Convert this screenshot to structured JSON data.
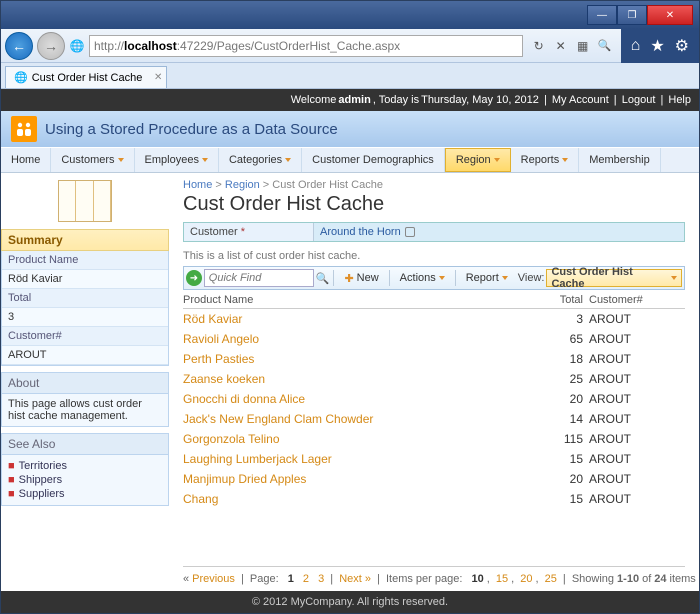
{
  "url": {
    "scheme": "http://",
    "host": "localhost",
    "port": ":47229",
    "path": "/Pages/CustOrderHist_Cache.aspx"
  },
  "tab_title": "Cust Order Hist Cache",
  "topbar": {
    "welcome_prefix": "Welcome ",
    "user": "admin",
    "date_prefix": ", Today is ",
    "date": "Thursday, May 10, 2012",
    "my_account": "My Account",
    "logout": "Logout",
    "help": "Help"
  },
  "app_title": "Using a Stored Procedure as a Data Source",
  "nav": {
    "home": "Home",
    "customers": "Customers",
    "employees": "Employees",
    "categories": "Categories",
    "customer_demo": "Customer Demographics",
    "region": "Region",
    "reports": "Reports",
    "membership": "Membership"
  },
  "sidebar": {
    "summary_h": "Summary",
    "product_name_lbl": "Product Name",
    "product_name_val": "Röd Kaviar",
    "total_lbl": "Total",
    "total_val": "3",
    "customer_lbl": "Customer#",
    "customer_val": "AROUT",
    "about_h": "About",
    "about_txt": "This page allows cust order hist cache management.",
    "seealso_h": "See Also",
    "links": [
      "Territories",
      "Shippers",
      "Suppliers"
    ]
  },
  "breadcrumb": {
    "home": "Home",
    "region": "Region",
    "leaf": "Cust Order Hist Cache"
  },
  "page_title": "Cust Order Hist Cache",
  "form": {
    "customer_lbl": "Customer",
    "customer_val": "Around the Horn"
  },
  "list_desc": "This is a list of cust order hist cache.",
  "toolbar": {
    "quick_find": "Quick Find",
    "new": "New",
    "actions": "Actions",
    "report": "Report",
    "view_lbl": "View:",
    "view_val": "Cust Order Hist Cache"
  },
  "columns": {
    "name": "Product Name",
    "total": "Total",
    "cust": "Customer#"
  },
  "rows": [
    {
      "name": "Röd Kaviar",
      "total": 3,
      "cust": "AROUT"
    },
    {
      "name": "Ravioli Angelo",
      "total": 65,
      "cust": "AROUT"
    },
    {
      "name": "Perth Pasties",
      "total": 18,
      "cust": "AROUT"
    },
    {
      "name": "Zaanse koeken",
      "total": 25,
      "cust": "AROUT"
    },
    {
      "name": "Gnocchi di donna Alice",
      "total": 20,
      "cust": "AROUT"
    },
    {
      "name": "Jack's New England Clam Chowder",
      "total": 14,
      "cust": "AROUT"
    },
    {
      "name": "Gorgonzola Telino",
      "total": 115,
      "cust": "AROUT"
    },
    {
      "name": "Laughing Lumberjack Lager",
      "total": 15,
      "cust": "AROUT"
    },
    {
      "name": "Manjimup Dried Apples",
      "total": 20,
      "cust": "AROUT"
    },
    {
      "name": "Chang",
      "total": 15,
      "cust": "AROUT"
    }
  ],
  "pager": {
    "prev": "Previous",
    "page_lbl": "Page:",
    "pages": [
      "1",
      "2",
      "3"
    ],
    "next": "Next »",
    "ipp_lbl": "Items per page:",
    "ipp": [
      "10",
      "15",
      "20",
      "25"
    ],
    "showing_pre": "Showing ",
    "showing_range": "1-10",
    "showing_mid": " of ",
    "showing_total": "24",
    "showing_post": " items"
  },
  "footer": "© 2012 MyCompany. All rights reserved."
}
